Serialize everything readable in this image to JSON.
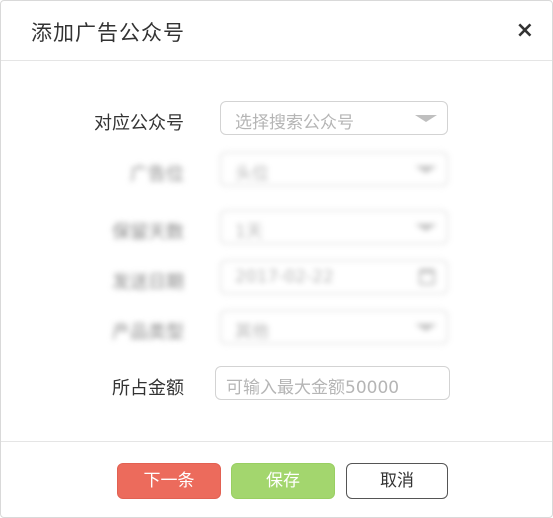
{
  "dialog": {
    "title": "添加广告公众号",
    "close_symbol": "×"
  },
  "form": {
    "account": {
      "label": "对应公众号",
      "placeholder": "选择搜索公众号"
    },
    "ad_slot": {
      "label": "广告位",
      "value": "头位"
    },
    "keep_days": {
      "label": "保留天数",
      "value": "1天"
    },
    "send_date": {
      "label": "发送日期",
      "value": "2017-02-22"
    },
    "product_type": {
      "label": "产品类型",
      "value": "其他"
    },
    "amount": {
      "label": "所占金额",
      "placeholder": "可输入最大金额50000"
    }
  },
  "footer": {
    "next_label": "下一条",
    "save_label": "保存",
    "cancel_label": "取消"
  },
  "colors": {
    "next_button": "#ec6b5c",
    "save_button": "#a3d66e"
  }
}
